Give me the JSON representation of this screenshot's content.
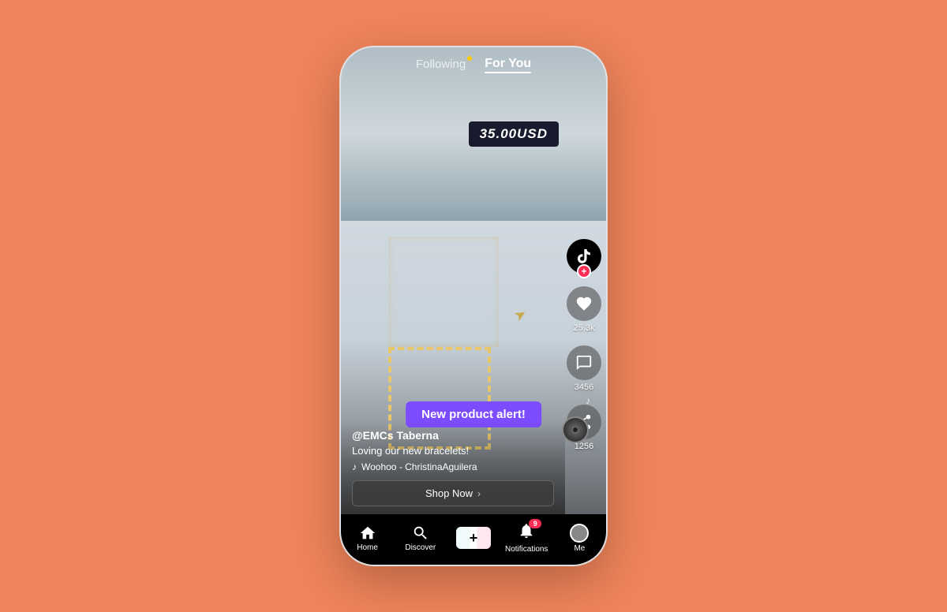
{
  "background": {
    "color": "#F0845A"
  },
  "phone": {
    "topNav": {
      "following": "Following",
      "forYou": "For You"
    },
    "video": {
      "priceTag": "35.00USD",
      "productAlert": "New product alert!",
      "username": "@EMCs Taberna",
      "caption": "Loving our new bracelets!",
      "music": "Woohoo - ChristinaAguilera",
      "shopNow": "Shop Now",
      "shopChevron": "›"
    },
    "sidebar": {
      "likeCount": "25.3k",
      "commentCount": "3456",
      "shareCount": "1256"
    },
    "bottomNav": {
      "home": "Home",
      "discover": "Discover",
      "addLabel": "+",
      "notifications": "Notifications",
      "notifBadge": "9",
      "me": "Me"
    }
  }
}
